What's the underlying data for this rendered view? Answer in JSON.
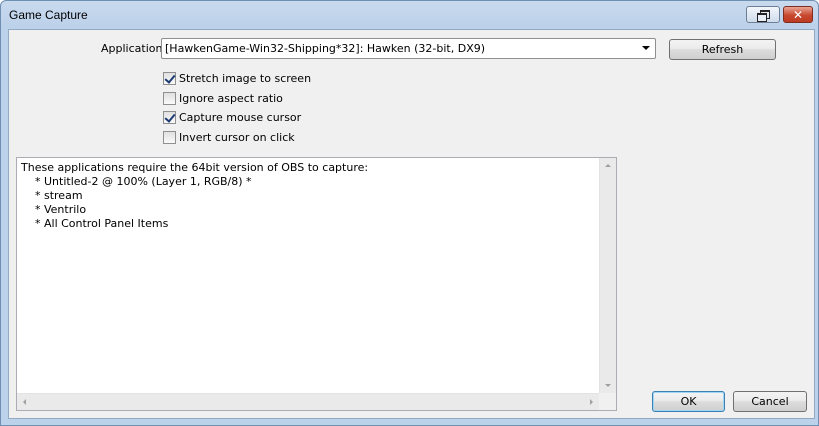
{
  "window": {
    "title": "Game Capture",
    "close_glyph": "✕"
  },
  "application": {
    "label": "Application:",
    "selected": "[HawkenGame-Win32-Shipping*32]: Hawken (32-bit, DX9)",
    "refresh_label": "Refresh"
  },
  "options": [
    {
      "label": "Stretch image to screen",
      "checked": true
    },
    {
      "label": "Ignore aspect ratio",
      "checked": false
    },
    {
      "label": "Capture mouse cursor",
      "checked": true
    },
    {
      "label": "Invert cursor on click",
      "checked": false
    }
  ],
  "info": {
    "lines": [
      "These applications require the 64bit version of OBS to capture:",
      "    * Untitled-2 @ 100% (Layer 1, RGB/8) *",
      "    * stream",
      "    * Ventrilo",
      "    * All Control Panel Items"
    ]
  },
  "footer": {
    "ok_label": "OK",
    "cancel_label": "Cancel"
  },
  "icons": {
    "restore": "restore-icon",
    "close": "close-icon",
    "dropdown": "chevron-down-icon"
  },
  "colors": {
    "title_bar": "#bcd1ea",
    "client_bg": "#f0f0f0",
    "close_button": "#c8492f",
    "default_button_border": "#3c7fb1"
  }
}
